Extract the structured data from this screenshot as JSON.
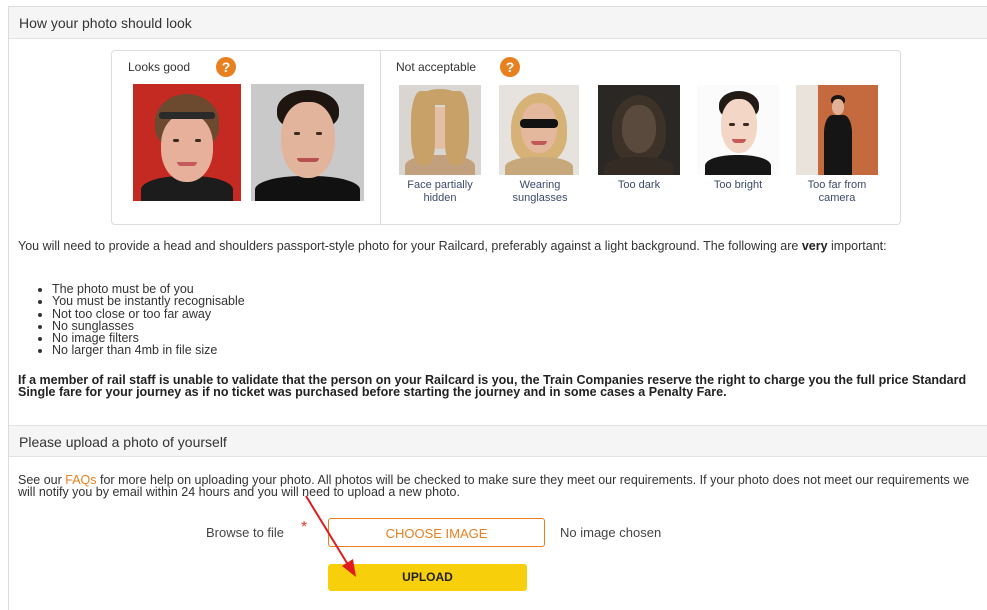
{
  "section_look": {
    "title": "How your photo should look",
    "good_label": "Looks good",
    "bad_label": "Not acceptable",
    "help_glyph": "?",
    "bad_examples": [
      {
        "caption": "Face partially hidden"
      },
      {
        "caption": "Wearing sunglasses"
      },
      {
        "caption": "Too dark"
      },
      {
        "caption": "Too bright"
      },
      {
        "caption": "Too far from camera"
      }
    ]
  },
  "intro": {
    "text": "You will need to provide a head and shoulders passport-style photo for your Railcard, preferably against a light background. The following are ",
    "emphasis": "very",
    "text_end": " important:"
  },
  "requirements": [
    "The photo must be of you",
    "You must be instantly recognisable",
    "Not too close or too far away",
    "No sunglasses",
    "No image filters",
    "No larger than 4mb in file size"
  ],
  "warning": "If a member of rail staff is unable to validate that the person on your Railcard is you, the Train Companies reserve the right to charge you the full price Standard Single fare for your journey as if no ticket was purchased before starting the journey and in some cases a Penalty Fare.",
  "section_upload": {
    "title": "Please upload a photo of yourself",
    "intro_before": "See our ",
    "faq_link": "FAQs",
    "intro_after": " for more help on uploading your photo. All photos will be checked to make sure they meet our requirements. If your photo does not meet our requirements we will notify you by email within 24 hours and you will need to upload a new photo.",
    "browse_label": "Browse to file",
    "required_mark": "*",
    "choose_button": "CHOOSE IMAGE",
    "file_status": "No image chosen",
    "upload_button": "UPLOAD"
  },
  "colors": {
    "accent_orange": "#e8801f",
    "upload_yellow": "#f7cf0a",
    "required_red": "#e03a2d",
    "annotation_arrow": "#e01b1b"
  },
  "icons": {
    "help": "question-circle-icon",
    "annotation": "red-arrow-annotation"
  }
}
